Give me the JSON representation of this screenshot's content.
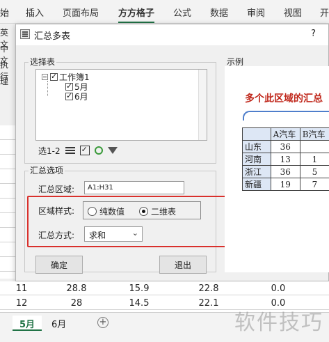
{
  "ribbon": {
    "tabs": [
      {
        "label": "始"
      },
      {
        "label": "插入"
      },
      {
        "label": "页面布局"
      },
      {
        "label": "方方格子"
      },
      {
        "label": "公式"
      },
      {
        "label": "数据"
      },
      {
        "label": "审阅"
      },
      {
        "label": "视图"
      },
      {
        "label": "开"
      }
    ]
  },
  "background_left": [
    "英文",
    "中文",
    "执行",
    "理"
  ],
  "dialog": {
    "title": "汇总多表",
    "help": "?",
    "select_group": "选择表",
    "tree": {
      "root": "工作簿1",
      "children": [
        "5月",
        "6月"
      ]
    },
    "toolbar_label": "选1-2",
    "options_group": "汇总选项",
    "range_label": "汇总区域:",
    "range_value": "A1:H31",
    "style_label": "区域样式:",
    "style_options": [
      "纯数值",
      "二维表"
    ],
    "style_selected": "二维表",
    "method_label": "汇总方式:",
    "method_value": "求和",
    "ok": "确定",
    "exit": "退出",
    "example_group": "示例",
    "example_title": "多个此区域的汇总",
    "example_table": {
      "headers": [
        "",
        "A汽车",
        "B汽车"
      ],
      "rows": [
        [
          "山东",
          "36",
          ""
        ],
        [
          "河南",
          "13",
          "1"
        ],
        [
          "浙江",
          "36",
          "5"
        ],
        [
          "新疆",
          "19",
          "7"
        ]
      ]
    }
  },
  "grid_rows": [
    [
      "11",
      "28.8",
      "15.9",
      "22.8",
      "0.0"
    ],
    [
      "12",
      "28",
      "14.5",
      "22.1",
      "0.0"
    ]
  ],
  "sheets": [
    "5月",
    "6月"
  ],
  "watermark": "软件技巧"
}
